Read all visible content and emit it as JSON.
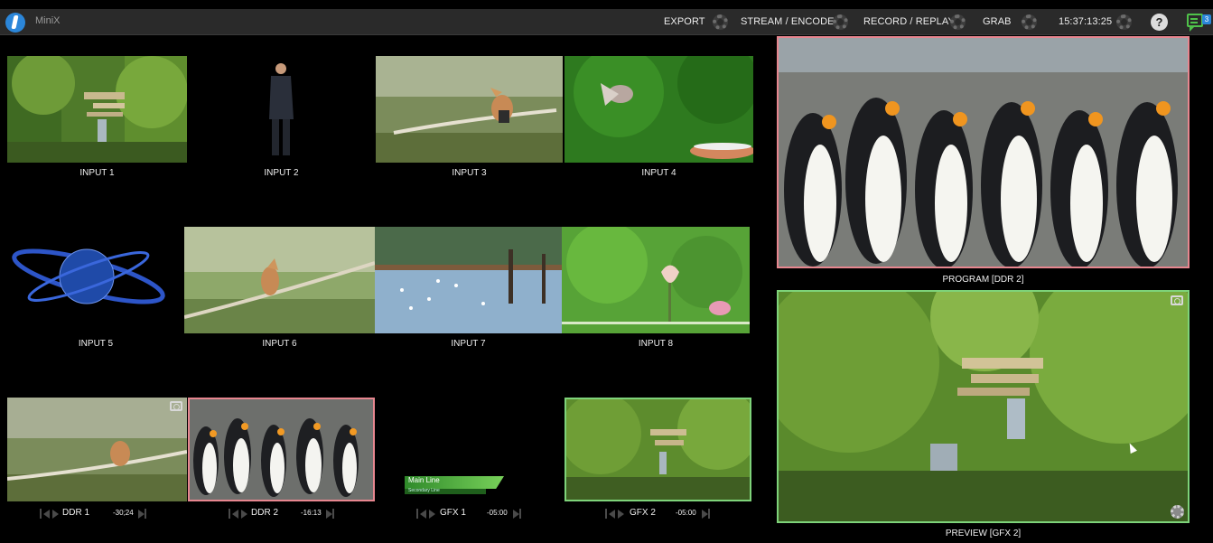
{
  "app": {
    "name": "MiniX"
  },
  "toolbar": {
    "export": "EXPORT",
    "stream": "STREAM / ENCODE",
    "record": "RECORD / REPLAY",
    "grab": "GRAB",
    "clock": "15:37:13:25",
    "help": "?",
    "notification_count": "3",
    "accent_color": "#4fc24a"
  },
  "inputs": [
    {
      "label": "INPUT 1"
    },
    {
      "label": "INPUT 2"
    },
    {
      "label": "INPUT 3"
    },
    {
      "label": "INPUT 4"
    },
    {
      "label": "INPUT 5"
    },
    {
      "label": "INPUT 6"
    },
    {
      "label": "INPUT 7"
    },
    {
      "label": "INPUT 8"
    }
  ],
  "players": [
    {
      "name": "DDR 1",
      "time": "-30;24"
    },
    {
      "name": "DDR 2",
      "time": "-16:13"
    },
    {
      "name": "GFX 1",
      "time": "-05:00"
    },
    {
      "name": "GFX 2",
      "time": "-05:00"
    }
  ],
  "gfx1_overlay": {
    "title": "Main Line",
    "subtitle": "Secondary Line"
  },
  "monitors": {
    "program": {
      "label": "PROGRAM [DDR 2]",
      "border_color": "#e7868f"
    },
    "preview": {
      "label": "PREVIEW [GFX 2]",
      "border_color": "#7ed37a"
    }
  }
}
